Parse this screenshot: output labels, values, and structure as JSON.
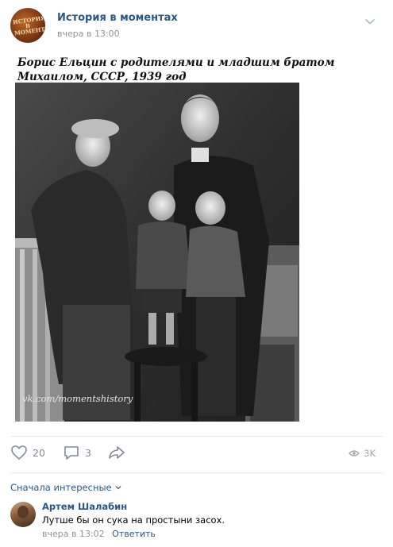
{
  "post": {
    "group_name": "История в моментах",
    "avatar_text": "ИСТОРИЯ В МОМЕНТАХ",
    "time": "вчера в 13:00",
    "title_line1": "Борис Ельцин с родителями и младшим братом",
    "title_line2": "Михаилом, СССР, 1939 год",
    "watermark": "vk.com/momentshistory"
  },
  "actions": {
    "likes": "20",
    "comments": "3",
    "views": "3K"
  },
  "comments_section": {
    "sort_label": "Сначала интересные",
    "items": [
      {
        "author": "Артем Шалабин",
        "text": "Лутше бы он сука на простыни засох.",
        "time": "вчера в 13:02",
        "reply_label": "Ответить"
      }
    ]
  },
  "colors": {
    "link": "#2a5885",
    "meta": "#939393",
    "icon": "#828a99",
    "divider": "#e7e8ec"
  }
}
